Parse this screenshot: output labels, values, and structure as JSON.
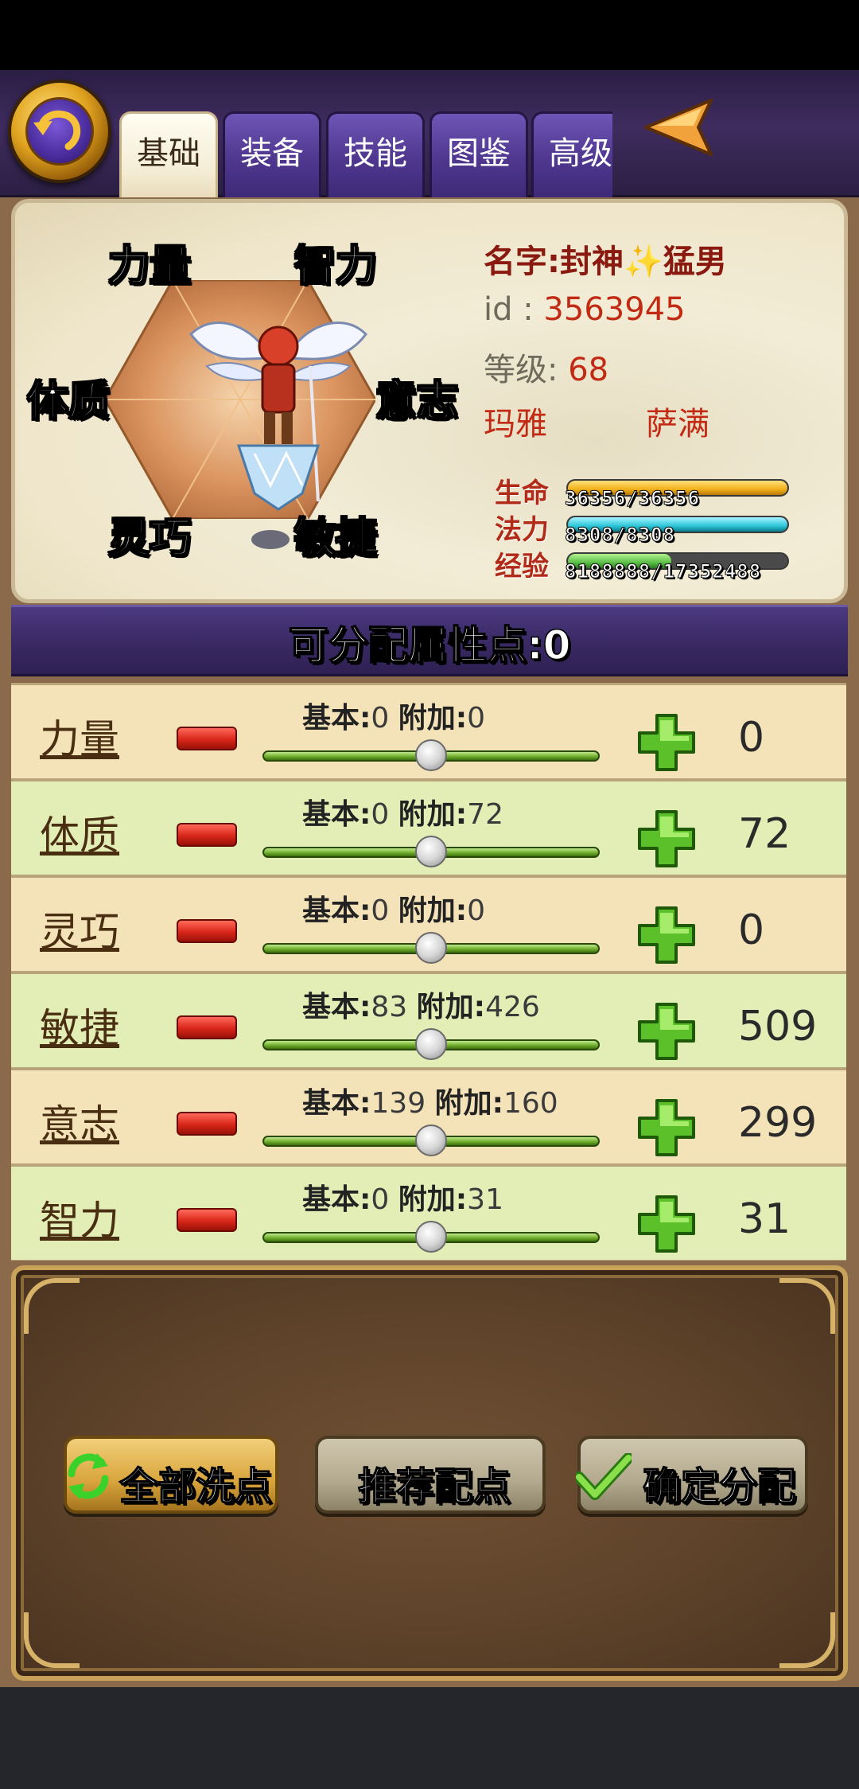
{
  "tabs": [
    "基础",
    "装备",
    "技能",
    "图鉴",
    "高级"
  ],
  "active_tab": "基础",
  "hex_labels": {
    "strength": "力量",
    "intelligence": "智力",
    "constitution": "体质",
    "will": "意志",
    "dexterity": "灵巧",
    "agility": "敏捷"
  },
  "character": {
    "name_label": "名字:",
    "name_prefix": "封神",
    "name_suffix": "猛男",
    "id_label": "id :",
    "id_value": "3563945",
    "level_label": "等级:",
    "level_value": "68",
    "race": "玛雅",
    "class": "萨满"
  },
  "bars": {
    "hp_label": "生命",
    "hp_text": "36356/36356",
    "hp_fraction": 1.0,
    "mp_label": "法力",
    "mp_text": "8308/8308",
    "mp_fraction": 1.0,
    "exp_label": "经验",
    "exp_text": "8188888/17352488",
    "exp_fraction": 0.47
  },
  "alloc": {
    "label": "可分配属性点:",
    "value": "0"
  },
  "base_label": "基本:",
  "bonus_label": "附加:",
  "attributes": [
    {
      "name": "力量",
      "base": "0",
      "bonus": "0",
      "total": "0"
    },
    {
      "name": "体质",
      "base": "0",
      "bonus": "72",
      "total": "72"
    },
    {
      "name": "灵巧",
      "base": "0",
      "bonus": "0",
      "total": "0"
    },
    {
      "name": "敏捷",
      "base": "83",
      "bonus": "426",
      "total": "509"
    },
    {
      "name": "意志",
      "base": "139",
      "bonus": "160",
      "total": "299"
    },
    {
      "name": "智力",
      "base": "0",
      "bonus": "31",
      "total": "31"
    }
  ],
  "slider_fraction": 0.5,
  "buttons": {
    "reset": "全部洗点",
    "recommend": "推荐配点",
    "confirm": "确定分配"
  },
  "colors": {
    "tab_purple": "#4f378f",
    "accent_red": "#c22a14",
    "hp_bar": "#f2b01a",
    "mp_bar": "#2cc6d8",
    "exp_bar": "#5cc04a"
  }
}
